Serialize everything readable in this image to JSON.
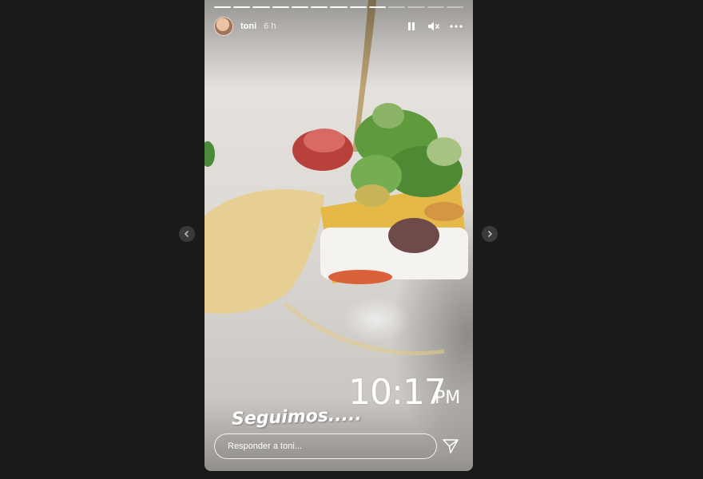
{
  "story": {
    "username": "toni",
    "time_ago": "6 h",
    "progress": {
      "total_segments": 13,
      "completed_segments": 9
    },
    "clock_time": "10:17",
    "clock_period": "PM",
    "caption": "Seguimos.....",
    "reply_placeholder": "Responder a toni..."
  },
  "icons": {
    "pause": "pause-icon",
    "mute": "speaker-muted-icon",
    "more": "more-options-icon",
    "send": "send-icon",
    "prev": "chevron-left-icon",
    "next": "chevron-right-icon"
  },
  "colors": {
    "background": "#1a1a1a",
    "nav_button": "#3a3a3a",
    "text": "#ffffff"
  }
}
